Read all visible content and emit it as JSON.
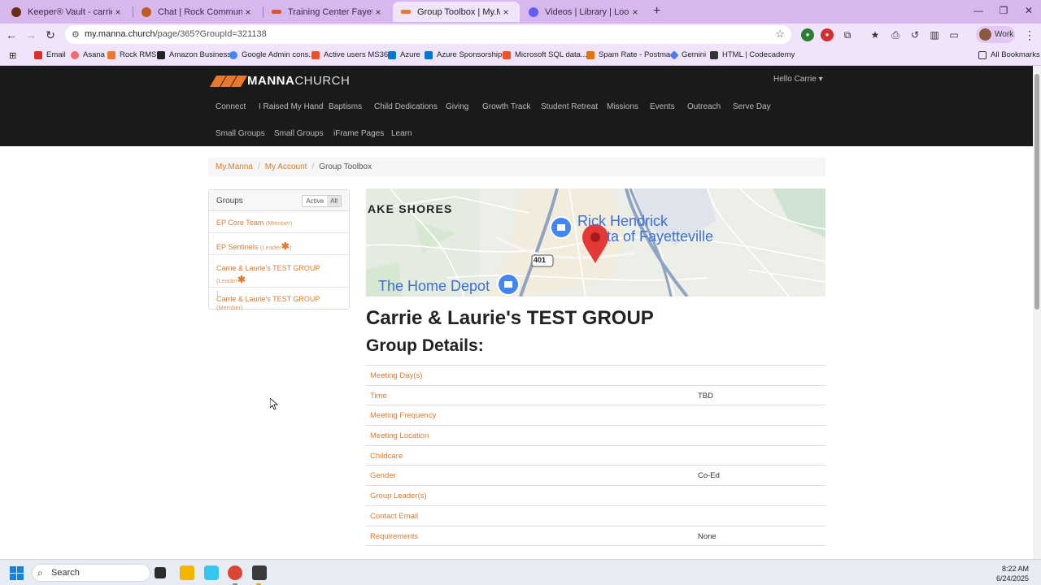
{
  "browser": {
    "tabs": [
      {
        "label": "Keeper® Vault - carrie.daws@m",
        "color": "#6b2c12",
        "active": false
      },
      {
        "label": "Chat | Rock Community",
        "color": "#c35a25",
        "active": false
      },
      {
        "label": "Training Center Fayetteville | Ro",
        "color": "#d9532c",
        "active": false
      },
      {
        "label": "Group Toolbox | My.Manna",
        "color": "#e8792e",
        "active": true
      },
      {
        "label": "Videos | Library | Loom",
        "color": "#625df5",
        "active": false
      }
    ],
    "tab_close": "×",
    "new_tab": "+",
    "url_host": "my.manna.church",
    "url_path": "/page/365?GroupId=321138",
    "profile_label": "Work",
    "bookmarks": [
      {
        "label": "Email",
        "color": "#d93025"
      },
      {
        "label": "Asana",
        "color": "#f06a6a"
      },
      {
        "label": "Rock RMS",
        "color": "#e8792e"
      },
      {
        "label": "Amazon Business",
        "color": "#222222"
      },
      {
        "label": "Google Admin cons...",
        "color": "#4285f4"
      },
      {
        "label": "Active users MS365",
        "color": "#f25022"
      },
      {
        "label": "Azure",
        "color": "#0078d4"
      },
      {
        "label": "Azure Sponsorships",
        "color": "#0078d4"
      },
      {
        "label": "Microsoft SQL data...",
        "color": "#f25022"
      },
      {
        "label": "Spam Rate - Postma...",
        "color": "#e37400"
      },
      {
        "label": "Gemini",
        "color": "#4b7bec"
      },
      {
        "label": "HTML | Codecademy",
        "color": "#333333"
      }
    ],
    "all_bookmarks": "All Bookmarks"
  },
  "site": {
    "logo_bold": "MANNA",
    "logo_light": "CHURCH",
    "accent": "#e8792e",
    "greeting": "Hello Carrie",
    "nav_row1": [
      "Connect",
      "I Raised My Hand",
      "Baptisms",
      "Child Dedications",
      "Giving",
      "Growth Track",
      "Student Retreat",
      "Missions",
      "Events",
      "Outreach",
      "Serve Day"
    ],
    "nav_row2": [
      "Small Groups",
      "Small Groups",
      "iFrame Pages",
      "Learn"
    ]
  },
  "breadcrumb": {
    "items": [
      "My.Manna",
      "My Account"
    ],
    "current": "Group Toolbox",
    "sep": "/"
  },
  "groups": {
    "title": "Groups",
    "toggle": [
      "Active",
      "All"
    ],
    "items": [
      {
        "name": "EP Core Team",
        "role": "(Member)",
        "star": ""
      },
      {
        "name": "EP Sentinels",
        "role": "(Leader",
        "star": "✱",
        "tail": ")"
      },
      {
        "name": "Carrie & Laurie's TEST GROUP",
        "role": "(Leader",
        "star": "✱",
        "tail": ")"
      },
      {
        "name": "Carrie & Laurie's TEST GROUP",
        "role": "(Member)",
        "star": ""
      }
    ]
  },
  "map": {
    "labels": [
      "AKE SHORES",
      "Rick Hendrick",
      "ta of Fayetteville",
      "The Home Depot"
    ],
    "road_shield": "401"
  },
  "group": {
    "title": "Carrie & Laurie's TEST GROUP",
    "details_heading": "Group Details:",
    "details": [
      {
        "key": "Meeting Day(s)",
        "value": ""
      },
      {
        "key": "Time",
        "value": "TBD"
      },
      {
        "key": "Meeting Frequency",
        "value": ""
      },
      {
        "key": "Meeting Location",
        "value": ""
      },
      {
        "key": "Childcare",
        "value": ""
      },
      {
        "key": "Gender",
        "value": "Co-Ed"
      },
      {
        "key": "Group Leader(s)",
        "value": ""
      },
      {
        "key": "Contact Email",
        "value": ""
      },
      {
        "key": "Requirements",
        "value": "None"
      }
    ]
  },
  "taskbar": {
    "search_label": "Search",
    "time": "8:22 AM",
    "date": "6/24/2025"
  }
}
